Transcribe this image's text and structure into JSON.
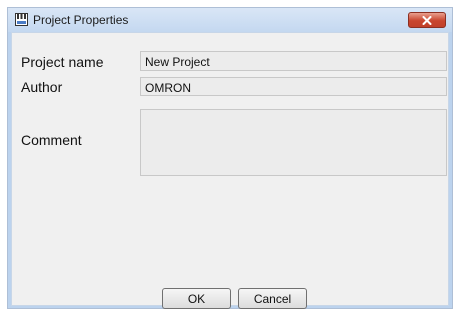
{
  "window": {
    "title": "Project Properties"
  },
  "form": {
    "project_name_label": "Project name",
    "project_name_value": "New Project",
    "author_label": "Author",
    "author_value": "OMRON",
    "comment_label": "Comment",
    "comment_value": ""
  },
  "buttons": {
    "ok_label": "OK",
    "cancel_label": "Cancel"
  },
  "icons": {
    "title_icon": "project-properties-icon",
    "close_icon": "close-icon"
  },
  "colors": {
    "titlebar": "#c4d8f0",
    "close_button": "#c9452e",
    "field_background": "#ececec"
  }
}
